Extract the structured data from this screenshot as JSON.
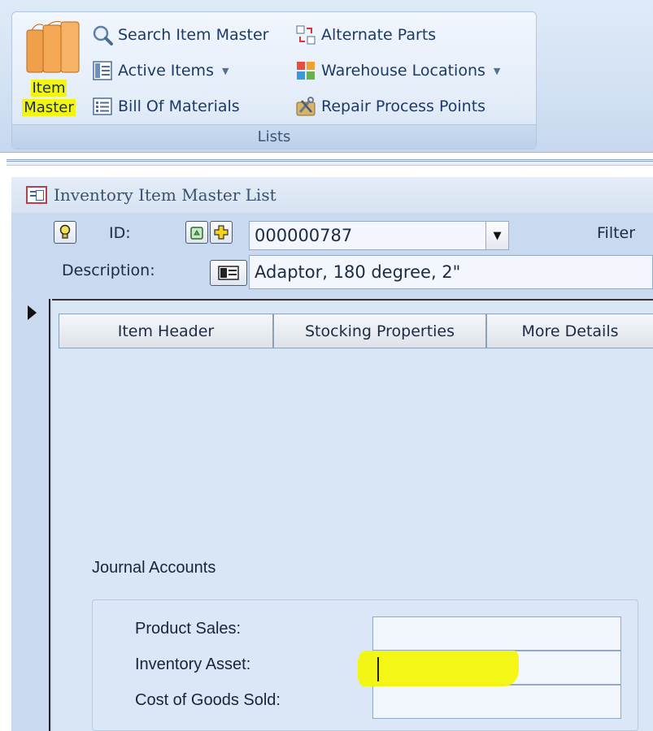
{
  "ribbon": {
    "item_master": {
      "line1": "Item",
      "line2": "Master"
    },
    "items": {
      "search": "Search Item Master",
      "active": "Active Items",
      "bom": "Bill Of Materials",
      "alternate": "Alternate Parts",
      "warehouse": "Warehouse Locations",
      "repair": "Repair Process Points"
    },
    "group_caption": "Lists"
  },
  "form": {
    "title": "Inventory Item Master List",
    "id_label": "ID:",
    "id_value": "000000787",
    "filter_label": "Filter",
    "description_label": "Description:",
    "description_value": "Adaptor, 180 degree, 2\""
  },
  "tabs": [
    "Item Header",
    "Stocking Properties",
    "More Details"
  ],
  "journal": {
    "title": "Journal Accounts",
    "fields": [
      {
        "label": "Product Sales:",
        "value": ""
      },
      {
        "label": "Inventory Asset:",
        "value": ""
      },
      {
        "label": "Cost of Goods Sold:",
        "value": ""
      }
    ]
  },
  "colors": {
    "highlight": "#f2f50f",
    "ribbon_text": "#1d3a66"
  }
}
